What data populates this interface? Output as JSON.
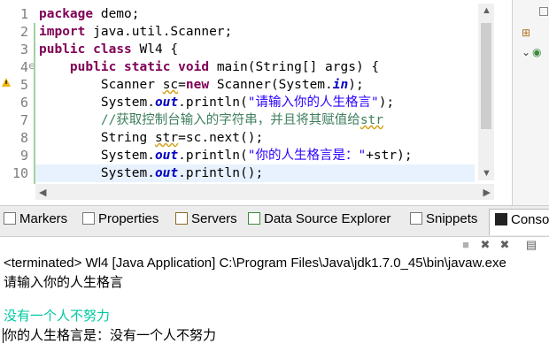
{
  "editor": {
    "line_numbers": [
      "1",
      "2",
      "3",
      "4",
      "5",
      "6",
      "7",
      "8",
      "9",
      "10"
    ],
    "lines": {
      "l1_kw": "package",
      "l1_rest": " demo;",
      "l2_kw": "import",
      "l2_rest": " java.util.Scanner;",
      "l3_kw1": "public",
      "l3_kw2": "class",
      "l3_rest": " Wl4 {",
      "l4_indent": "    ",
      "l4_kw1": "public",
      "l4_kw2": "static",
      "l4_kw3": "void",
      "l4_rest": " main(String[] args) {",
      "l5_indent": "        ",
      "l5_a": "Scanner ",
      "l5_var": "sc",
      "l5_eq": "=",
      "l5_kw": "new",
      "l5_b": " Scanner(System.",
      "l5_fld": "in",
      "l5_c": ");",
      "l6_indent": "        ",
      "l6_a": "System.",
      "l6_fld": "out",
      "l6_b": ".println(",
      "l6_str": "\"请输入你的人生格言\"",
      "l6_c": ");",
      "l7_indent": "        ",
      "l7_cmt": "//获取控制台输入的字符串，并且将其赋值给",
      "l7_sq": "str",
      "l8_indent": "        ",
      "l8_a": "String ",
      "l8_var": "str",
      "l8_b": "=sc.next();",
      "l9_indent": "        ",
      "l9_a": "System.",
      "l9_fld": "out",
      "l9_b": ".println(",
      "l9_str": "\"你的人生格言是：\"",
      "l9_c": "+str);",
      "l10_indent": "        ",
      "l10_a": "System.",
      "l10_fld": "out",
      "l10_b": ".println();"
    }
  },
  "tabs": {
    "markers": "Markers",
    "properties": "Properties",
    "servers": "Servers",
    "data_source_explorer": "Data Source Explorer",
    "snippets": "Snippets",
    "console": "Conso"
  },
  "console": {
    "header": "<terminated> Wl4 [Java Application] C:\\Program Files\\Java\\jdk1.7.0_45\\bin\\javaw.exe",
    "output_1": "请输入你的人生格言",
    "input_1": "没有一个人不努力",
    "output_2": "你的人生格言是：没有一个人不努力"
  },
  "colors": {
    "keyword": "#7f0055",
    "string": "#2a00ff",
    "comment": "#3f7f5f",
    "field": "#0000c0",
    "console_input": "#00c8a0"
  }
}
